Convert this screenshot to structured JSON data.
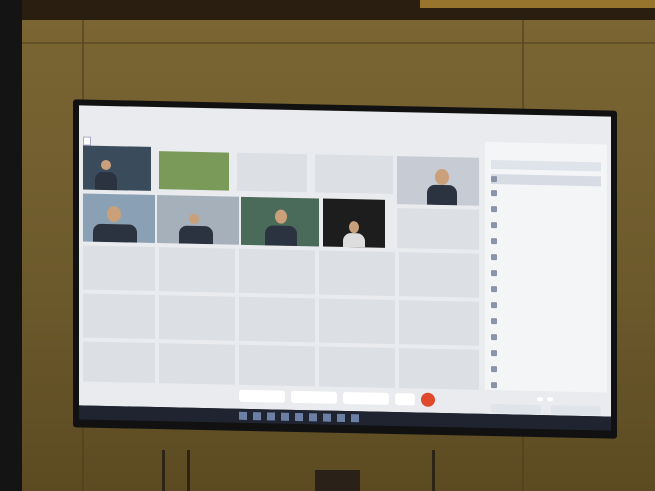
{
  "scene": {
    "description_tags": [
      "photo-of-tv",
      "video-conference"
    ],
    "colors": {
      "wall": "#6d5a2c",
      "screen": "#e9ebee",
      "end_call": "#e04a2a"
    }
  },
  "meeting": {
    "menu_items": [
      "",
      "",
      "",
      "",
      "",
      "",
      "",
      ""
    ],
    "tab_label": "",
    "tiles": [
      {
        "label": ""
      },
      {
        "label": ""
      },
      {
        "label": ""
      },
      {
        "label": ""
      },
      {
        "label": ""
      },
      {
        "label": ""
      },
      {
        "label": ""
      },
      {
        "label": ""
      },
      {
        "label": ""
      },
      {
        "label": ""
      },
      {
        "label": ""
      },
      {
        "label": ""
      },
      {
        "label": ""
      },
      {
        "label": ""
      },
      {
        "label": ""
      },
      {
        "label": ""
      },
      {
        "label": ""
      },
      {
        "label": ""
      },
      {
        "label": ""
      },
      {
        "label": ""
      }
    ],
    "toolbar": [
      "",
      "",
      "",
      ""
    ],
    "panel": {
      "title": "",
      "participants": [
        "",
        "",
        "",
        "",
        "",
        "",
        "",
        "",
        "",
        "",
        "",
        "",
        "",
        "",
        "",
        "",
        ""
      ]
    },
    "right_buttons": [
      "",
      ""
    ]
  }
}
